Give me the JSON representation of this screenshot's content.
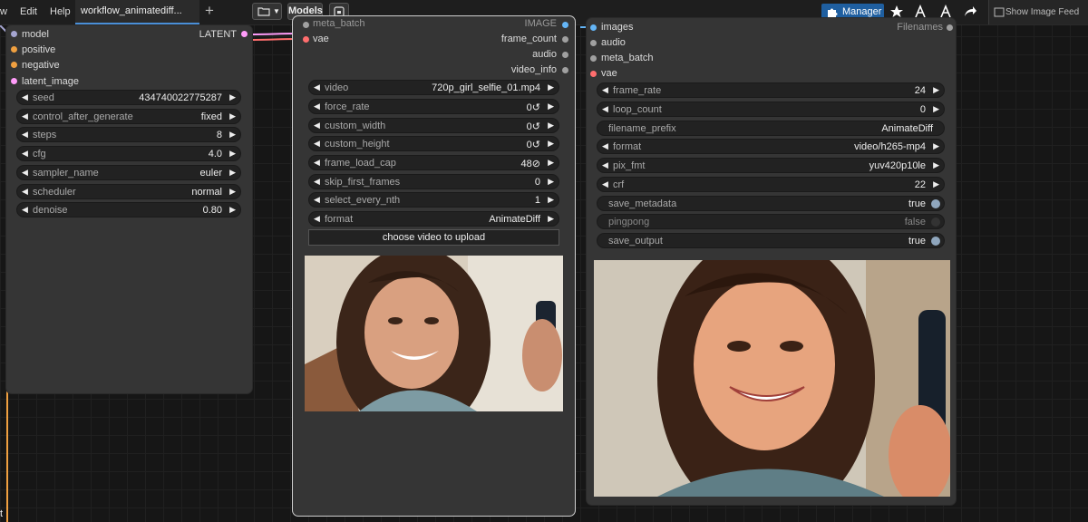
{
  "menu": {
    "partial_item": "w",
    "edit": "Edit",
    "help": "Help"
  },
  "workflow_tab": {
    "label": "workflow_animatediff..."
  },
  "toolbar": {
    "models_label": "Models",
    "manager_label": "Manager",
    "feed_label": "Show Image Feed"
  },
  "ksampler": {
    "inputs": [
      {
        "label": "model",
        "color": "#a5a5d0"
      },
      {
        "label": "positive",
        "color": "#f0a040"
      },
      {
        "label": "negative",
        "color": "#f0a040"
      },
      {
        "label": "latent_image",
        "color": "#ff9cf9"
      }
    ],
    "output": {
      "label": "LATENT",
      "color": "#ff9cf9"
    },
    "widgets": [
      {
        "label": "seed",
        "value": "434740022775287"
      },
      {
        "label": "control_after_generate",
        "value": "fixed"
      },
      {
        "label": "steps",
        "value": "8"
      },
      {
        "label": "cfg",
        "value": "4.0"
      },
      {
        "label": "sampler_name",
        "value": "euler"
      },
      {
        "label": "scheduler",
        "value": "normal"
      },
      {
        "label": "denoise",
        "value": "0.80"
      }
    ]
  },
  "load_video": {
    "inputs": [
      {
        "label": "meta_batch",
        "color": "#a0a0a0"
      },
      {
        "label": "vae",
        "color": "#ff6e6e"
      }
    ],
    "outputs": [
      {
        "label": "IMAGE",
        "color": "#64b5f6"
      },
      {
        "label": "frame_count",
        "color": "#a0a0a0"
      },
      {
        "label": "audio",
        "color": "#a0a0a0"
      },
      {
        "label": "video_info",
        "color": "#a0a0a0"
      }
    ],
    "widgets": [
      {
        "label": "video",
        "value": "720p_girl_selfie_01.mp4"
      },
      {
        "label": "force_rate",
        "value": "0↺"
      },
      {
        "label": "custom_width",
        "value": "0↺"
      },
      {
        "label": "custom_height",
        "value": "0↺"
      },
      {
        "label": "frame_load_cap",
        "value": "48⊘"
      },
      {
        "label": "skip_first_frames",
        "value": "0"
      },
      {
        "label": "select_every_nth",
        "value": "1"
      },
      {
        "label": "format",
        "value": "AnimateDiff"
      }
    ],
    "upload_label": "choose video to upload"
  },
  "video_combine": {
    "inputs": [
      {
        "label": "images",
        "color": "#64b5f6"
      },
      {
        "label": "audio",
        "color": "#a0a0a0"
      },
      {
        "label": "meta_batch",
        "color": "#a0a0a0"
      },
      {
        "label": "vae",
        "color": "#ff6e6e"
      }
    ],
    "output": {
      "label": "Filenames",
      "color": "#a0a0a0"
    },
    "widgets": [
      {
        "kind": "combo",
        "label": "frame_rate",
        "value": "24"
      },
      {
        "kind": "combo",
        "label": "loop_count",
        "value": "0"
      },
      {
        "kind": "text",
        "label": "filename_prefix",
        "value": "AnimateDiff"
      },
      {
        "kind": "combo",
        "label": "format",
        "value": "video/h265-mp4"
      },
      {
        "kind": "combo",
        "label": "pix_fmt",
        "value": "yuv420p10le"
      },
      {
        "kind": "combo",
        "label": "crf",
        "value": "22"
      },
      {
        "kind": "toggle",
        "label": "save_metadata",
        "value": "true",
        "on": true
      },
      {
        "kind": "toggle",
        "label": "pingpong",
        "value": "false",
        "on": false
      },
      {
        "kind": "toggle",
        "label": "save_output",
        "value": "true",
        "on": true
      }
    ]
  },
  "edge_label": "t"
}
